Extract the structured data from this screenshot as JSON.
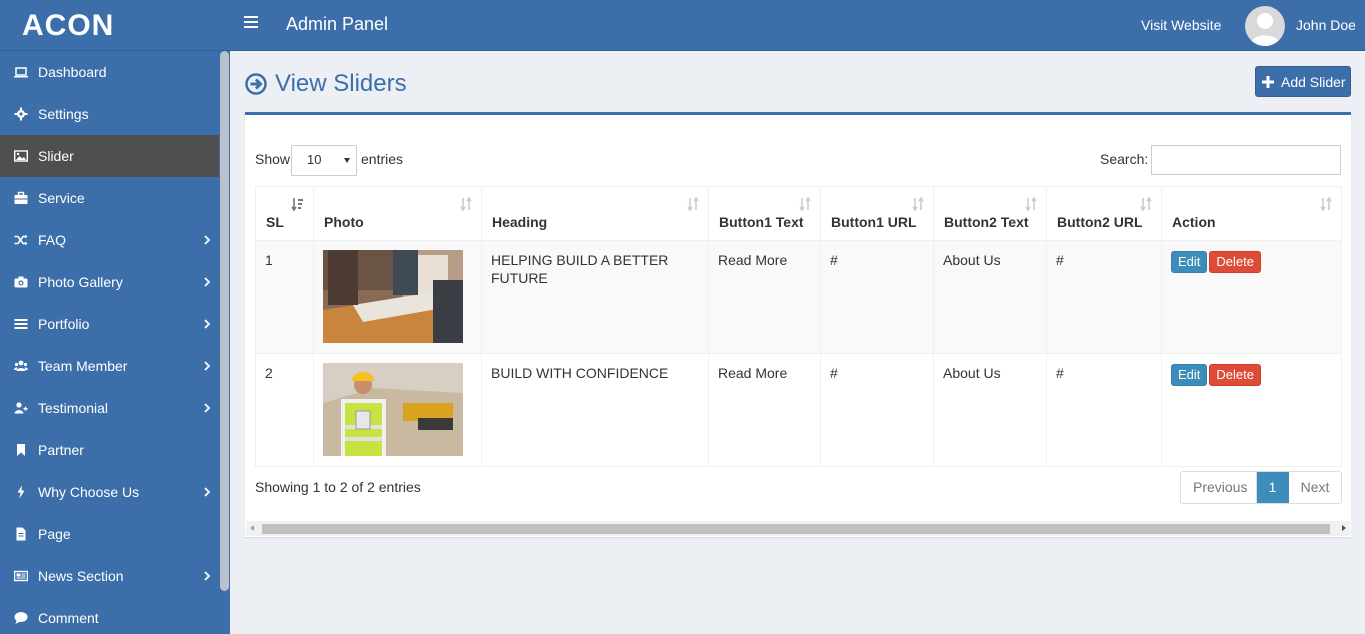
{
  "brand": "ACON",
  "header": {
    "title": "Admin Panel",
    "visit_website": "Visit Website",
    "user_name": "John Doe"
  },
  "sidebar": {
    "items": [
      {
        "label": "Dashboard",
        "icon": "laptop-icon",
        "has_arrow": false
      },
      {
        "label": "Settings",
        "icon": "gear-icon",
        "has_arrow": false
      },
      {
        "label": "Slider",
        "icon": "image-icon",
        "has_arrow": false,
        "active": true
      },
      {
        "label": "Service",
        "icon": "briefcase-icon",
        "has_arrow": false
      },
      {
        "label": "FAQ",
        "icon": "shuffle-icon",
        "has_arrow": true
      },
      {
        "label": "Photo Gallery",
        "icon": "camera-icon",
        "has_arrow": true
      },
      {
        "label": "Portfolio",
        "icon": "list-icon",
        "has_arrow": true
      },
      {
        "label": "Team Member",
        "icon": "users-icon",
        "has_arrow": true
      },
      {
        "label": "Testimonial",
        "icon": "user-plus-icon",
        "has_arrow": true
      },
      {
        "label": "Partner",
        "icon": "bookmark-icon",
        "has_arrow": false
      },
      {
        "label": "Why Choose Us",
        "icon": "bolt-icon",
        "has_arrow": true
      },
      {
        "label": "Page",
        "icon": "file-icon",
        "has_arrow": false
      },
      {
        "label": "News Section",
        "icon": "newspaper-icon",
        "has_arrow": true
      },
      {
        "label": "Comment",
        "icon": "comment-icon",
        "has_arrow": false
      }
    ]
  },
  "page": {
    "title": "View Sliders",
    "add_button": "Add Slider"
  },
  "table_controls": {
    "show_label": "Show",
    "entries_value": "10",
    "entries_label": "entries",
    "search_label": "Search:",
    "search_value": ""
  },
  "table": {
    "columns": [
      "SL",
      "Photo",
      "Heading",
      "Button1 Text",
      "Button1 URL",
      "Button2 Text",
      "Button2 URL",
      "Action"
    ],
    "rows": [
      {
        "sl": "1",
        "photo": "construction-plans-photo",
        "heading": "HELPING BUILD A BETTER FUTURE",
        "b1_text": "Read More",
        "b1_url": "#",
        "b2_text": "About Us",
        "b2_url": "#"
      },
      {
        "sl": "2",
        "photo": "construction-worker-photo",
        "heading": "BUILD WITH CONFIDENCE",
        "b1_text": "Read More",
        "b1_url": "#",
        "b2_text": "About Us",
        "b2_url": "#"
      }
    ],
    "edit_label": "Edit",
    "delete_label": "Delete"
  },
  "footer": {
    "info": "Showing 1 to 2 of 2 entries",
    "previous": "Previous",
    "current_page": "1",
    "next": "Next"
  },
  "colors": {
    "primary": "#3c6fa9",
    "active_sidebar": "#4f4f4f",
    "edit": "#3c8dbc",
    "delete": "#dd4b39"
  }
}
